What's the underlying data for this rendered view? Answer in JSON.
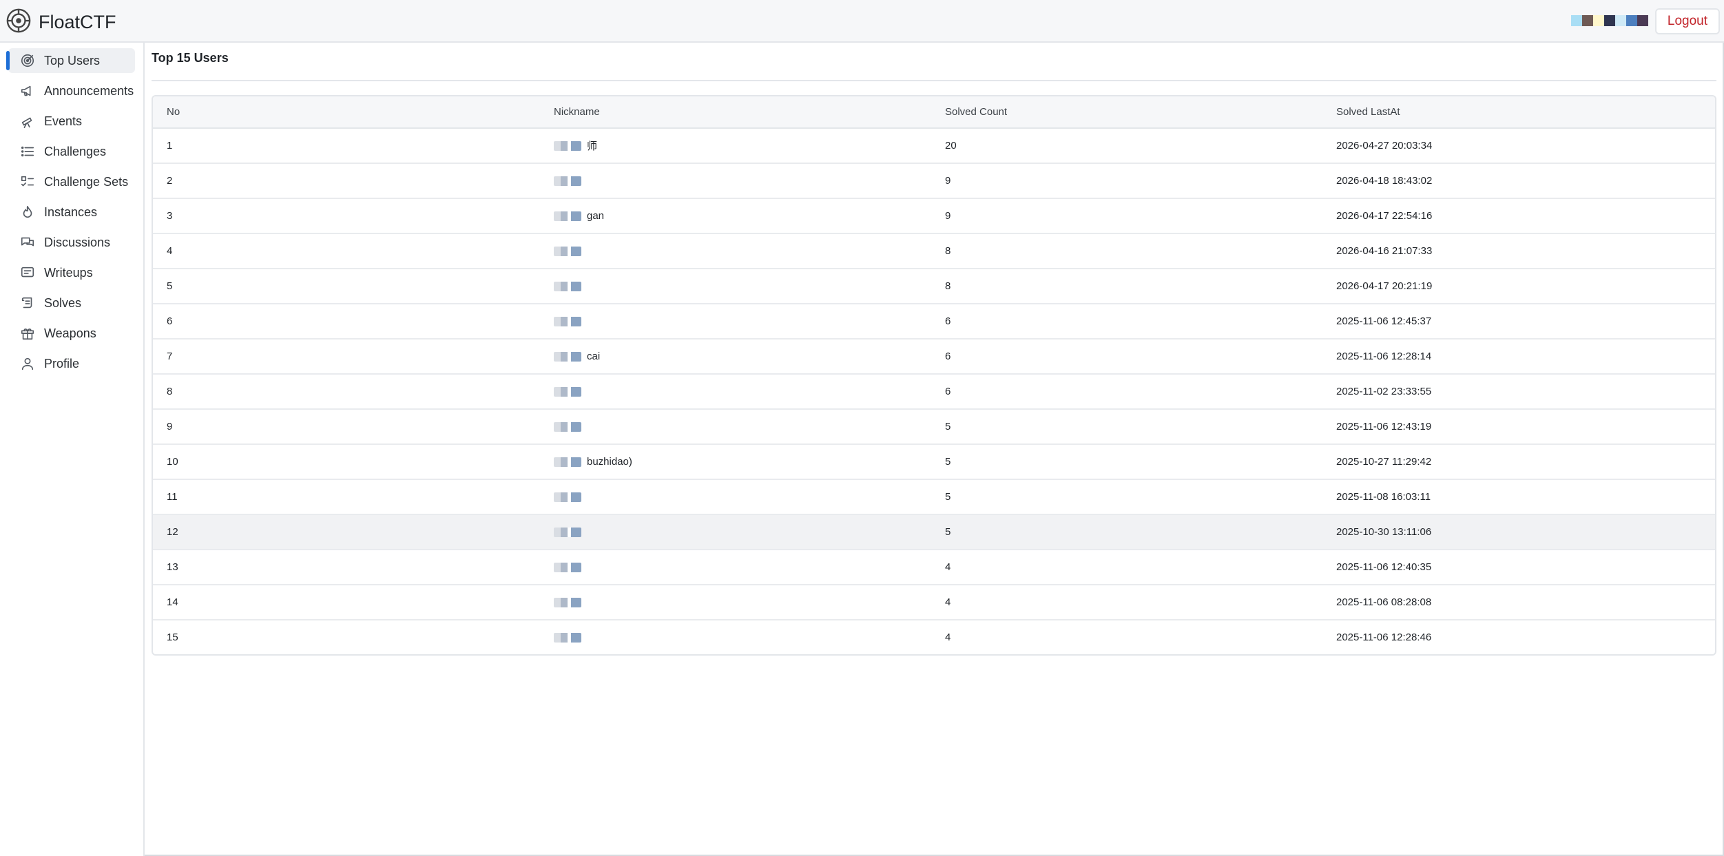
{
  "header": {
    "brand": "FloatCTF",
    "logout_label": "Logout",
    "user_badge_colors": [
      "#a9def5",
      "#6e5a55",
      "#fff7cc",
      "#2f3550",
      "#cfeaf7",
      "#4c7fbf",
      "#4b3a55"
    ]
  },
  "sidebar": {
    "items": [
      {
        "label": "Top Users",
        "icon": "target-icon",
        "active": true
      },
      {
        "label": "Announcements",
        "icon": "megaphone-icon"
      },
      {
        "label": "Events",
        "icon": "telescope-icon"
      },
      {
        "label": "Challenges",
        "icon": "list-icon"
      },
      {
        "label": "Challenge Sets",
        "icon": "checklist-icon"
      },
      {
        "label": "Instances",
        "icon": "flame-icon"
      },
      {
        "label": "Discussions",
        "icon": "chat-icon"
      },
      {
        "label": "Writeups",
        "icon": "message-square-icon"
      },
      {
        "label": "Solves",
        "icon": "scroll-icon"
      },
      {
        "label": "Weapons",
        "icon": "gift-icon"
      },
      {
        "label": "Profile",
        "icon": "user-icon"
      }
    ]
  },
  "main": {
    "title": "Top 15 Users",
    "table": {
      "headers": [
        "No",
        "Nickname",
        "Solved Count",
        "Solved LastAt"
      ],
      "rows": [
        {
          "no": "1",
          "nickname": "师",
          "solved": "20",
          "last": "2026-04-27 20:03:34"
        },
        {
          "no": "2",
          "nickname": "",
          "solved": "9",
          "last": "2026-04-18 18:43:02"
        },
        {
          "no": "3",
          "nickname": "gan",
          "solved": "9",
          "last": "2026-04-17 22:54:16"
        },
        {
          "no": "4",
          "nickname": "",
          "solved": "8",
          "last": "2026-04-16 21:07:33"
        },
        {
          "no": "5",
          "nickname": "",
          "solved": "8",
          "last": "2026-04-17 20:21:19"
        },
        {
          "no": "6",
          "nickname": "",
          "solved": "6",
          "last": "2025-11-06 12:45:37"
        },
        {
          "no": "7",
          "nickname": "cai",
          "solved": "6",
          "last": "2025-11-06 12:28:14"
        },
        {
          "no": "8",
          "nickname": "",
          "solved": "6",
          "last": "2025-11-02 23:33:55"
        },
        {
          "no": "9",
          "nickname": "",
          "solved": "5",
          "last": "2025-11-06 12:43:19"
        },
        {
          "no": "10",
          "nickname": "buzhidao)",
          "solved": "5",
          "last": "2025-10-27 11:29:42"
        },
        {
          "no": "11",
          "nickname": "",
          "solved": "5",
          "last": "2025-11-08 16:03:11"
        },
        {
          "no": "12",
          "nickname": "",
          "solved": "5",
          "last": "2025-10-30 13:11:06",
          "highlight": true
        },
        {
          "no": "13",
          "nickname": "",
          "solved": "4",
          "last": "2025-11-06 12:40:35"
        },
        {
          "no": "14",
          "nickname": "",
          "solved": "4",
          "last": "2025-11-06 08:28:08"
        },
        {
          "no": "15",
          "nickname": "",
          "solved": "4",
          "last": "2025-11-06 12:28:46"
        }
      ]
    }
  }
}
